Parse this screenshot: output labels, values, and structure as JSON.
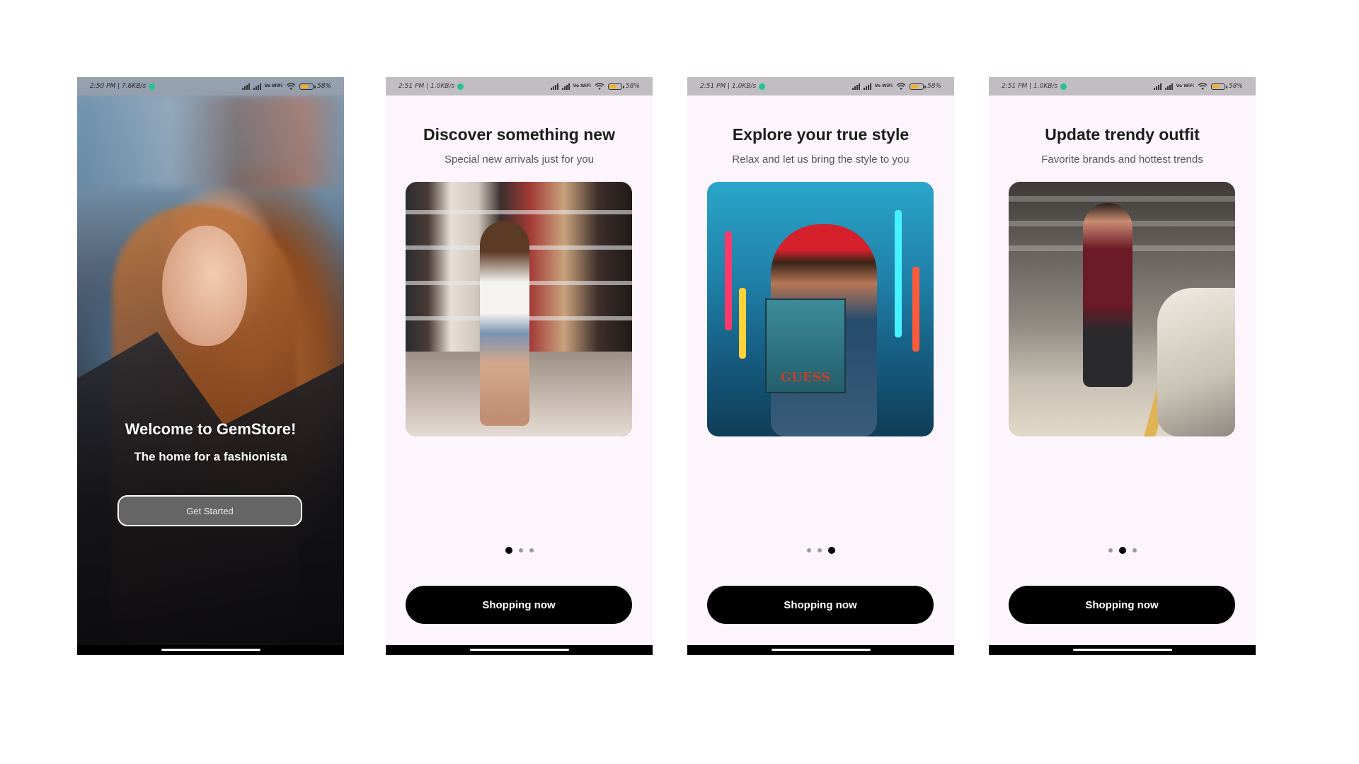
{
  "screens": [
    {
      "status": {
        "time": "2:50 PM | 7.6KB/s",
        "vowifi": "Vo WiFi",
        "battery": "58%",
        "battery_fraction": 0.58
      },
      "welcome_title": "Welcome to GemStore!",
      "welcome_subtitle": "The home for a fashionista",
      "button_label": "Get Started"
    },
    {
      "status": {
        "time": "2:51 PM | 1.0KB/s",
        "vowifi": "Vo WiFi",
        "battery": "58%",
        "battery_fraction": 0.58
      },
      "title": "Discover something new",
      "subtitle": "Special new arrivals just for you",
      "image": "shopper-in-store-aisle",
      "active_dot": 0,
      "button_label": "Shopping now"
    },
    {
      "status": {
        "time": "2:51 PM | 1.0KB/s",
        "vowifi": "Vo WiFi",
        "battery": "58%",
        "battery_fraction": 0.58
      },
      "title": "Explore your true style",
      "subtitle": "Relax and let us bring the style to you",
      "image": "woman-with-shopping-bag-neon-street",
      "bag_text": "GUESS",
      "active_dot": 2,
      "button_label": "Shopping now"
    },
    {
      "status": {
        "time": "2:51 PM | 1.0KB/s",
        "vowifi": "Vo WiFi",
        "battery": "58%",
        "battery_fraction": 0.58
      },
      "title": "Update trendy outfit",
      "subtitle": "Favorite brands and hottest trends",
      "image": "woman-with-bags-parking-garage",
      "active_dot": 1,
      "button_label": "Shopping now"
    }
  ],
  "colors": {
    "screen_bg": "#fdf5fd",
    "button_bg": "#000000",
    "button_text": "#ffffff",
    "dot_active": "#000000",
    "dot_inactive": "#9a9a9a"
  }
}
